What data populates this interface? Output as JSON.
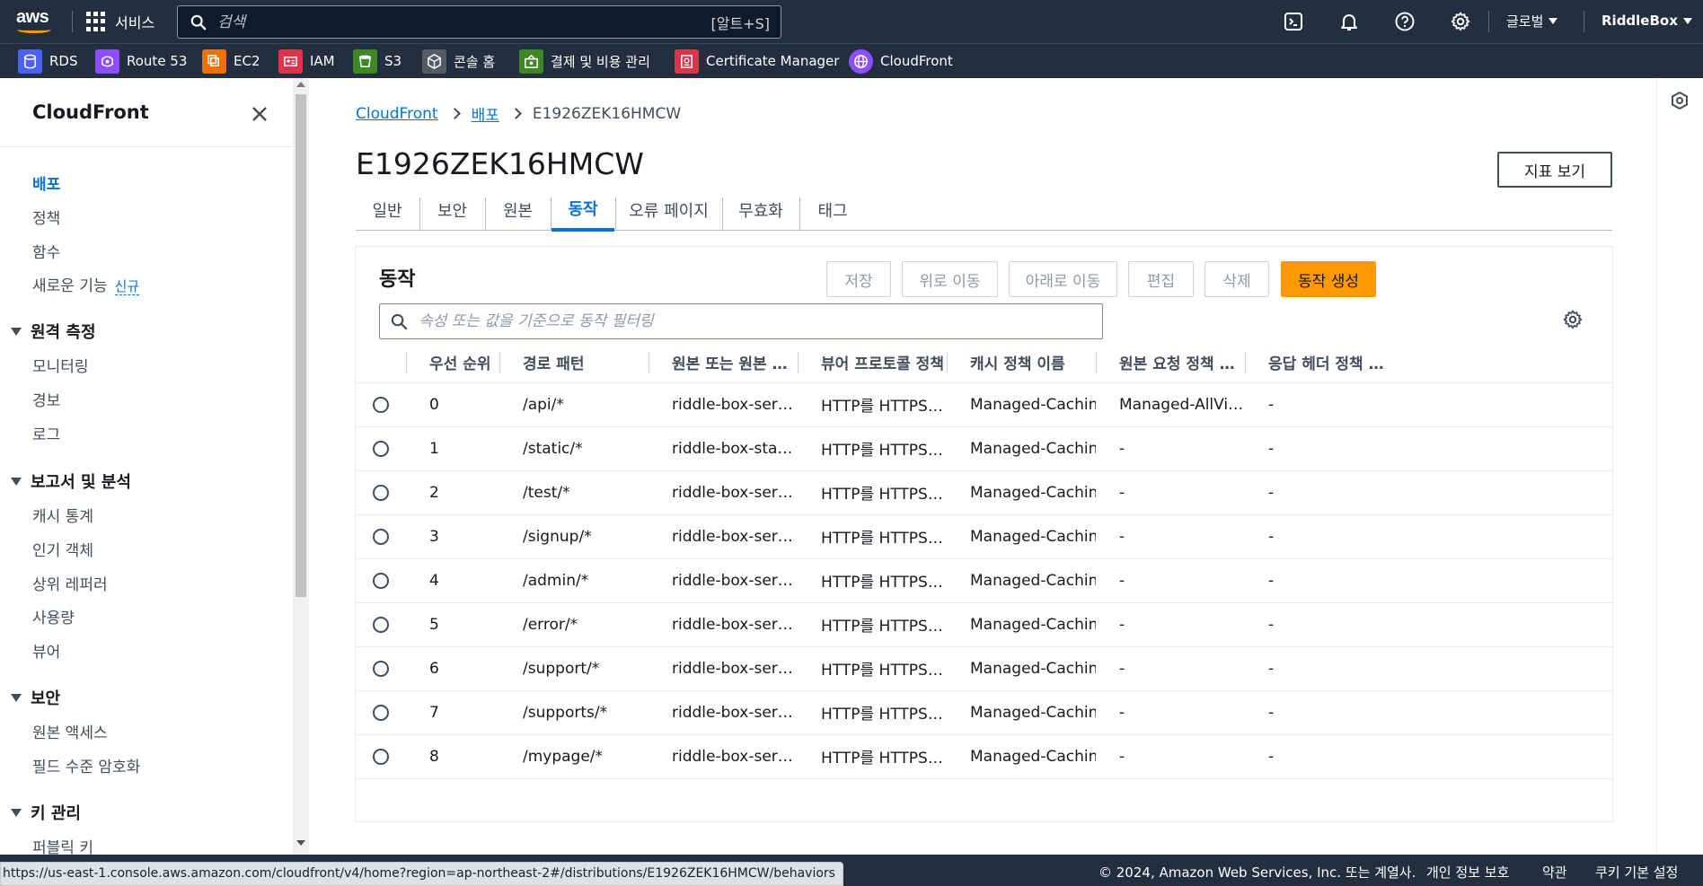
{
  "topnav": {
    "logo_text": "aws",
    "services_label": "서비스",
    "search_placeholder": "검색",
    "search_shortcut": "[알트+S]",
    "icons": [
      "cloudshell-icon",
      "notifications-bell-icon",
      "help-icon",
      "settings-gear-icon"
    ],
    "region_label": "글로벌",
    "account_label": "RiddleBox"
  },
  "favorites": [
    {
      "label": "RDS",
      "icon": "rds-icon",
      "color": "#4d61f4"
    },
    {
      "label": "Route 53",
      "icon": "route53-icon",
      "color": "#8c4fff"
    },
    {
      "label": "EC2",
      "icon": "ec2-icon",
      "color": "#ed7100"
    },
    {
      "label": "IAM",
      "icon": "iam-icon",
      "color": "#dd344c"
    },
    {
      "label": "S3",
      "icon": "s3-icon",
      "color": "#3f8624"
    },
    {
      "label": "콘솔 홈",
      "icon": "console-home-icon",
      "color": "#545b64"
    },
    {
      "label": "결제 및 비용 관리",
      "icon": "billing-icon",
      "color": "#3f8624"
    },
    {
      "label": "Certificate Manager",
      "icon": "certificate-manager-icon",
      "color": "#dd344c"
    },
    {
      "label": "CloudFront",
      "icon": "cloudfront-icon",
      "color": "#8c4fff"
    }
  ],
  "sidebar": {
    "title": "CloudFront",
    "top_items": [
      {
        "label": "배포",
        "active": true
      },
      {
        "label": "정책"
      },
      {
        "label": "함수"
      },
      {
        "label": "새로운 기능",
        "badge": "신규"
      }
    ],
    "sections": [
      {
        "title": "원격 측정",
        "items": [
          "모니터링",
          "경보",
          "로그"
        ]
      },
      {
        "title": "보고서 및 분석",
        "items": [
          "캐시 통계",
          "인기 객체",
          "상위 레퍼러",
          "사용량",
          "뷰어"
        ]
      },
      {
        "title": "보안",
        "items": [
          "원본 액세스",
          "필드 수준 암호화"
        ]
      },
      {
        "title": "키 관리",
        "items": [
          "퍼블릭 키"
        ]
      }
    ]
  },
  "breadcrumb": {
    "items": [
      "CloudFront",
      "배포"
    ],
    "current": "E1926ZEK16HMCW"
  },
  "page": {
    "title": "E1926ZEK16HMCW",
    "metrics_button": "지표 보기"
  },
  "tabs": [
    {
      "label": "일반"
    },
    {
      "label": "보안"
    },
    {
      "label": "원본"
    },
    {
      "label": "동작",
      "active": true
    },
    {
      "label": "오류 페이지"
    },
    {
      "label": "무효화"
    },
    {
      "label": "태그"
    }
  ],
  "behaviors": {
    "title": "동작",
    "buttons": {
      "save": "저장",
      "move_up": "위로 이동",
      "move_down": "아래로 이동",
      "edit": "편집",
      "delete": "삭제",
      "create": "동작 생성"
    },
    "filter_placeholder": "속성 또는 값을 기준으로 동작 필터링",
    "columns": [
      "우선 순위",
      "경로 패턴",
      "원본 또는 원본 …",
      "뷰어 프로토콜 정책",
      "캐시 정책 이름",
      "원본 요청 정책 …",
      "응답 헤더 정책 …"
    ],
    "rows": [
      {
        "priority": "0",
        "path": "/api/*",
        "origin": "riddle-box-serve…",
        "viewer": "HTTP를 HTTPS…",
        "cache": "Managed-CachingDisa",
        "origin_request": "Managed-AllViewer",
        "response_headers": "-"
      },
      {
        "priority": "1",
        "path": "/static/*",
        "origin": "riddle-box-static…",
        "viewer": "HTTP를 HTTPS…",
        "cache": "Managed-CachingOpti",
        "origin_request": "-",
        "response_headers": "-"
      },
      {
        "priority": "2",
        "path": "/test/*",
        "origin": "riddle-box-serve…",
        "viewer": "HTTP를 HTTPS…",
        "cache": "Managed-CachingDisa",
        "origin_request": "-",
        "response_headers": "-"
      },
      {
        "priority": "3",
        "path": "/signup/*",
        "origin": "riddle-box-serve…",
        "viewer": "HTTP를 HTTPS…",
        "cache": "Managed-CachingDisa",
        "origin_request": "-",
        "response_headers": "-"
      },
      {
        "priority": "4",
        "path": "/admin/*",
        "origin": "riddle-box-serve…",
        "viewer": "HTTP를 HTTPS…",
        "cache": "Managed-CachingDisa",
        "origin_request": "-",
        "response_headers": "-"
      },
      {
        "priority": "5",
        "path": "/error/*",
        "origin": "riddle-box-serve…",
        "viewer": "HTTP를 HTTPS…",
        "cache": "Managed-CachingOpti",
        "origin_request": "-",
        "response_headers": "-"
      },
      {
        "priority": "6",
        "path": "/support/*",
        "origin": "riddle-box-serve…",
        "viewer": "HTTP를 HTTPS…",
        "cache": "Managed-CachingDisa",
        "origin_request": "-",
        "response_headers": "-"
      },
      {
        "priority": "7",
        "path": "/supports/*",
        "origin": "riddle-box-serve…",
        "viewer": "HTTP를 HTTPS…",
        "cache": "Managed-CachingOpti",
        "origin_request": "-",
        "response_headers": "-"
      },
      {
        "priority": "8",
        "path": "/mypage/*",
        "origin": "riddle-box-serve…",
        "viewer": "HTTP를 HTTPS…",
        "cache": "Managed-CachingDisa",
        "origin_request": "-",
        "response_headers": "-"
      }
    ]
  },
  "footer": {
    "copyright": "© 2024, Amazon Web Services, Inc. 또는 계열사.",
    "links": [
      "개인 정보 보호",
      "약관",
      "쿠키 기본 설정"
    ]
  },
  "status_url": "https://us-east-1.console.aws.amazon.com/cloudfront/v4/home?region=ap-northeast-2#/distributions/E1926ZEK16HMCW/behaviors",
  "colors": {
    "nav_bg": "#232f3e",
    "link_blue": "#0972d3",
    "primary_orange": "#ff9900"
  }
}
